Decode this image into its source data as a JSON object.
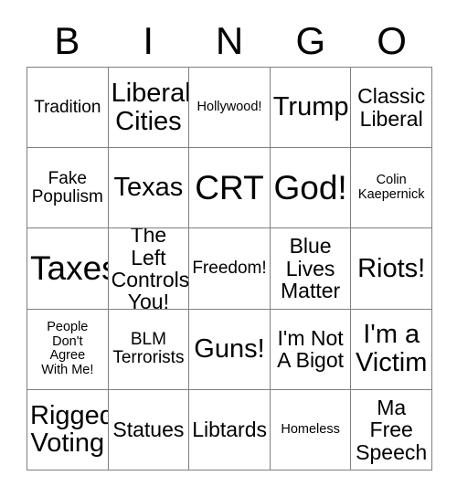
{
  "card": {
    "title": "BINGO",
    "header_letters": [
      "B",
      "I",
      "N",
      "G",
      "O"
    ],
    "grid_size": "5x5",
    "colors": {
      "background": "#ffffff",
      "text": "#000000",
      "grid_line": "#808080"
    },
    "rows": [
      [
        {
          "text": "Tradition",
          "size": "sm"
        },
        {
          "text": "Liberal\nCities",
          "size": "lg"
        },
        {
          "text": "Hollywood!",
          "size": "xs"
        },
        {
          "text": "Trump",
          "size": "lg"
        },
        {
          "text": "Classic\nLiberal",
          "size": "md"
        }
      ],
      [
        {
          "text": "Fake\nPopulism",
          "size": "sm"
        },
        {
          "text": "Texas",
          "size": "lg"
        },
        {
          "text": "CRT",
          "size": "xl"
        },
        {
          "text": "God!",
          "size": "xl"
        },
        {
          "text": "Colin\nKaepernick",
          "size": "xs"
        }
      ],
      [
        {
          "text": "Taxes",
          "size": "xl"
        },
        {
          "text": "The Left\nControls\nYou!",
          "size": "md"
        },
        {
          "text": "Freedom!",
          "size": "sm"
        },
        {
          "text": "Blue\nLives\nMatter",
          "size": "md"
        },
        {
          "text": "Riots!",
          "size": "lg"
        }
      ],
      [
        {
          "text": "People\nDon't\nAgree\nWith Me!",
          "size": "xs"
        },
        {
          "text": "BLM\nTerrorists",
          "size": "sm"
        },
        {
          "text": "Guns!",
          "size": "lg"
        },
        {
          "text": "I'm Not\nA Bigot",
          "size": "md"
        },
        {
          "text": "I'm a\nVictim",
          "size": "lg"
        }
      ],
      [
        {
          "text": "Rigged\nVoting",
          "size": "lg"
        },
        {
          "text": "Statues",
          "size": "md"
        },
        {
          "text": "Libtards",
          "size": "md"
        },
        {
          "text": "Homeless",
          "size": "xs"
        },
        {
          "text": "Ma\nFree\nSpeech",
          "size": "md"
        }
      ]
    ]
  }
}
